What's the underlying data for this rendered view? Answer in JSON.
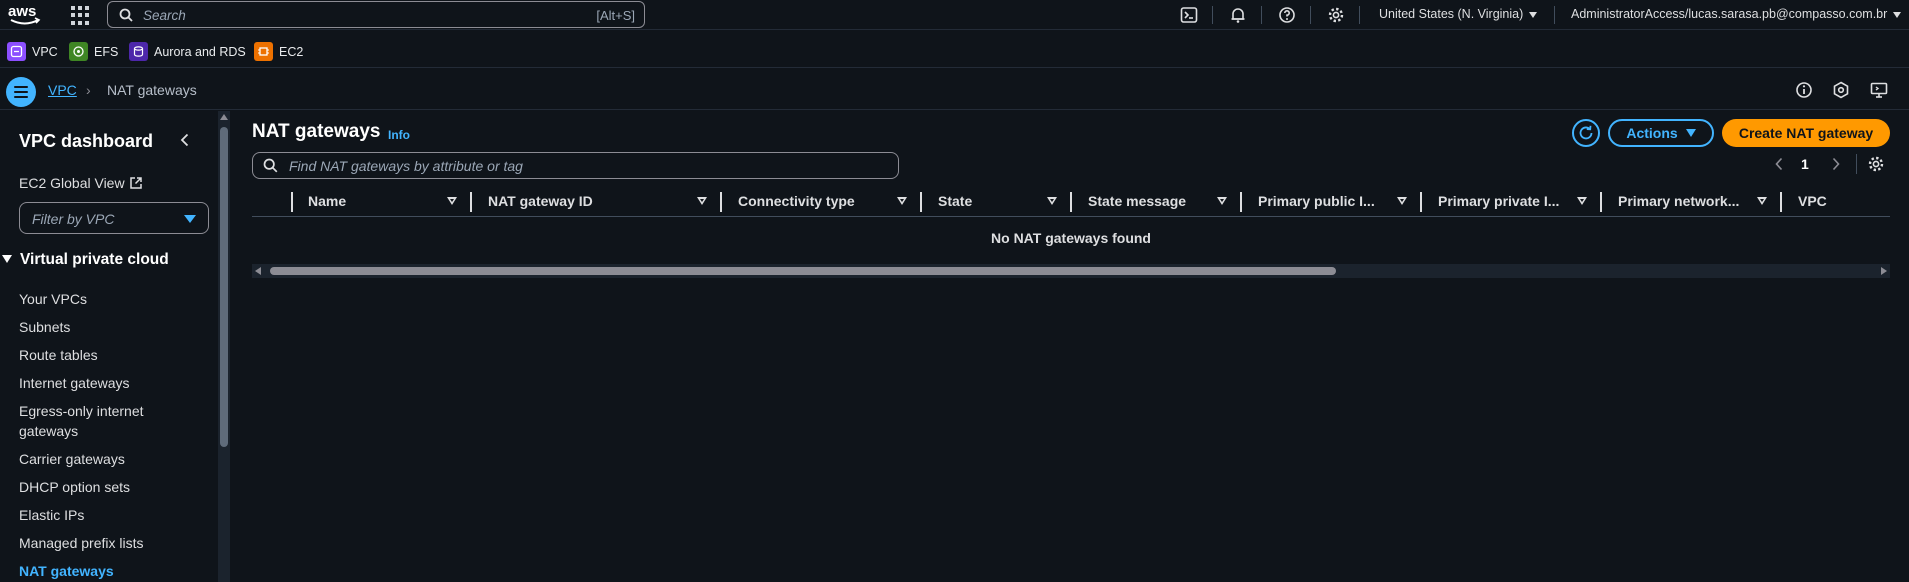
{
  "topnav": {
    "logo_text": "aws",
    "search_placeholder": "Search",
    "search_shortcut": "[Alt+S]",
    "region": "United States (N. Virginia)",
    "account": "AdministratorAccess/lucas.sarasa.pb@compasso.com.br"
  },
  "favorites": [
    {
      "label": "VPC",
      "icon": "vpc-icon",
      "color": "#8c4fff"
    },
    {
      "label": "EFS",
      "icon": "efs-icon",
      "color": "#3f8624"
    },
    {
      "label": "Aurora and RDS",
      "icon": "rds-icon",
      "color": "#4d27aa"
    },
    {
      "label": "EC2",
      "icon": "ec2-icon",
      "color": "#ed7100"
    }
  ],
  "breadcrumb": {
    "service": "VPC",
    "current": "NAT gateways"
  },
  "sidebar": {
    "title": "VPC dashboard",
    "global_view": "EC2 Global View",
    "filter_placeholder": "Filter by VPC",
    "section": "Virtual private cloud",
    "items": [
      {
        "label": "Your VPCs"
      },
      {
        "label": "Subnets"
      },
      {
        "label": "Route tables"
      },
      {
        "label": "Internet gateways"
      },
      {
        "label": "Egress-only internet gateways"
      },
      {
        "label": "Carrier gateways"
      },
      {
        "label": "DHCP option sets"
      },
      {
        "label": "Elastic IPs"
      },
      {
        "label": "Managed prefix lists"
      },
      {
        "label": "NAT gateways",
        "active": true
      }
    ]
  },
  "main": {
    "title": "NAT gateways",
    "info": "Info",
    "actions_label": "Actions",
    "create_label": "Create NAT gateway",
    "find_placeholder": "Find NAT gateways by attribute or tag",
    "page": "1",
    "columns": [
      "Name",
      "NAT gateway ID",
      "Connectivity type",
      "State",
      "State message",
      "Primary public I...",
      "Primary private I...",
      "Primary network...",
      "VPC"
    ],
    "empty_message": "No NAT gateways found"
  },
  "colors": {
    "background": "#0f141a",
    "link": "#42b4ff",
    "primary_button": "#ff9900"
  }
}
